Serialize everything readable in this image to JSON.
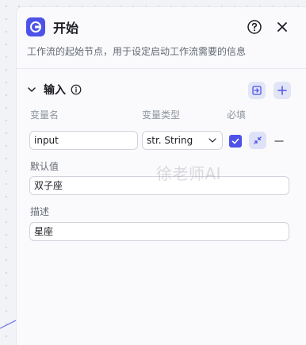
{
  "panel": {
    "title": "开始",
    "description": "工作流的起始节点，用于设定启动工作流需要的信息",
    "icons": {
      "node": "start-node-icon",
      "help": "help-circle-icon",
      "close": "close-icon"
    }
  },
  "input_section": {
    "title": "输入",
    "columns": {
      "name": "变量名",
      "type": "变量类型",
      "required": "必填"
    },
    "variable": {
      "name": "input",
      "type": "str. String",
      "required": true,
      "default_label": "默认值",
      "default_value": "双子座",
      "desc_label": "描述",
      "desc_value": "星座"
    }
  },
  "watermark": "徐老师AI",
  "colors": {
    "accent": "#4d53e8",
    "button_bg": "#e2e5f6"
  }
}
